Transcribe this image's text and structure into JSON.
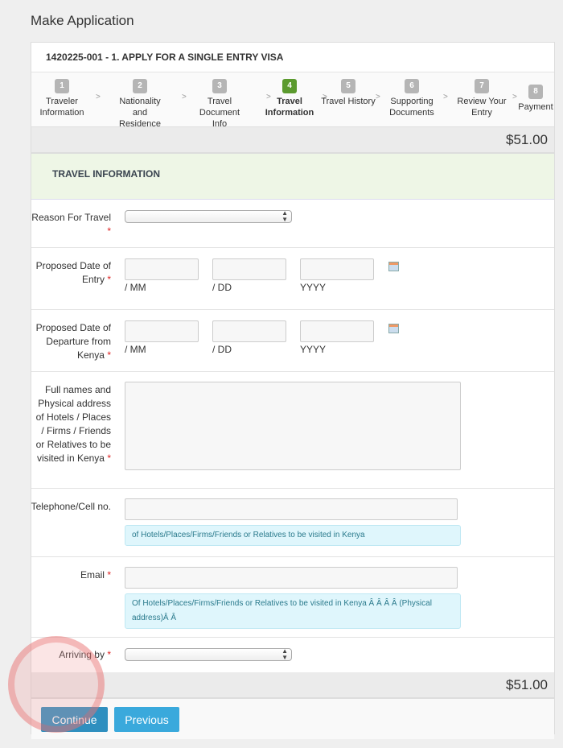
{
  "page_title": "Make Application",
  "application_header": "1420225-001 - 1. APPLY FOR A SINGLE ENTRY VISA",
  "steps": [
    {
      "num": "1",
      "label": "Traveler Information",
      "active": false
    },
    {
      "num": "2",
      "label": "Nationality and Residence",
      "active": false
    },
    {
      "num": "3",
      "label": "Travel Document Info",
      "active": false
    },
    {
      "num": "4",
      "label": "Travel Information",
      "active": true
    },
    {
      "num": "5",
      "label": "Travel History",
      "active": false
    },
    {
      "num": "6",
      "label": "Supporting Documents",
      "active": false
    },
    {
      "num": "7",
      "label": "Review Your Entry",
      "active": false
    },
    {
      "num": "8",
      "label": "Payment",
      "active": false
    }
  ],
  "step_separator": ">",
  "price": "$51.00",
  "section_title": "TRAVEL INFORMATION",
  "form": {
    "reason": {
      "label": "Reason For Travel",
      "value": ""
    },
    "entry_date": {
      "label": "Proposed Date of Entry",
      "mm": "/ MM",
      "dd": "/ DD",
      "yyyy": "YYYY"
    },
    "departure_date": {
      "label": "Proposed Date of Departure from Kenya",
      "mm": "/ MM",
      "dd": "/ DD",
      "yyyy": "YYYY"
    },
    "address": {
      "label": "Full names and Physical address of Hotels / Places / Firms / Friends or Relatives to be visited in Kenya",
      "value": ""
    },
    "phone": {
      "label": "Telephone/Cell no.",
      "value": "",
      "help": "of Hotels/Places/Firms/Friends or Relatives to be visited in Kenya"
    },
    "email": {
      "label": "Email",
      "value": "",
      "help": "Of Hotels/Places/Firms/Friends or Relatives to be visited in Kenya Â Â Â Â (Physical address)Â Â"
    },
    "arriving": {
      "label": "Arriving by",
      "value": ""
    },
    "required_mark": "*"
  },
  "buttons": {
    "continue": "Continue",
    "previous": "Previous"
  },
  "colors": {
    "active_step": "#5b9a2e",
    "button": "#3aa9dc",
    "section_bg": "#eef6e6",
    "help_bg": "#dff6fc"
  }
}
